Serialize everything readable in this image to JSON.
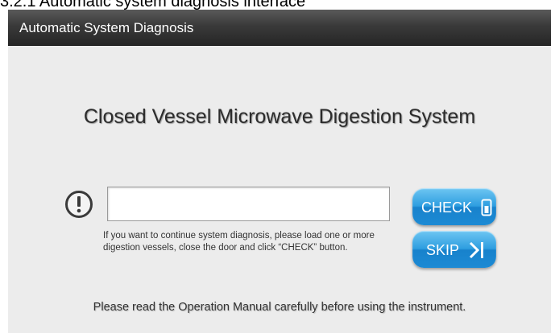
{
  "document": {
    "heading_fragment": "3.2.1 Automatic system diagnosis interface"
  },
  "window": {
    "title": "Automatic System Diagnosis"
  },
  "main": {
    "heading": "Closed Vessel Microwave Digestion System",
    "status_value": "",
    "instruction_line1": "If you want to continue system diagnosis, please load  one or more",
    "instruction_line2": "digestion vessels, close the door and click “CHECK” button.",
    "footer_note": "Please read the Operation Manual carefully before using the instrument."
  },
  "buttons": {
    "check_label": "CHECK",
    "check_icon": "vessel-icon",
    "skip_label": "SKIP",
    "skip_icon": "skip-forward-icon"
  },
  "icons": {
    "alert": "exclamation-circle-icon"
  },
  "colors": {
    "titlebar": "#3a3a3a",
    "background": "#ececec",
    "button_blue": "#2e9ee0",
    "text": "#333333"
  }
}
